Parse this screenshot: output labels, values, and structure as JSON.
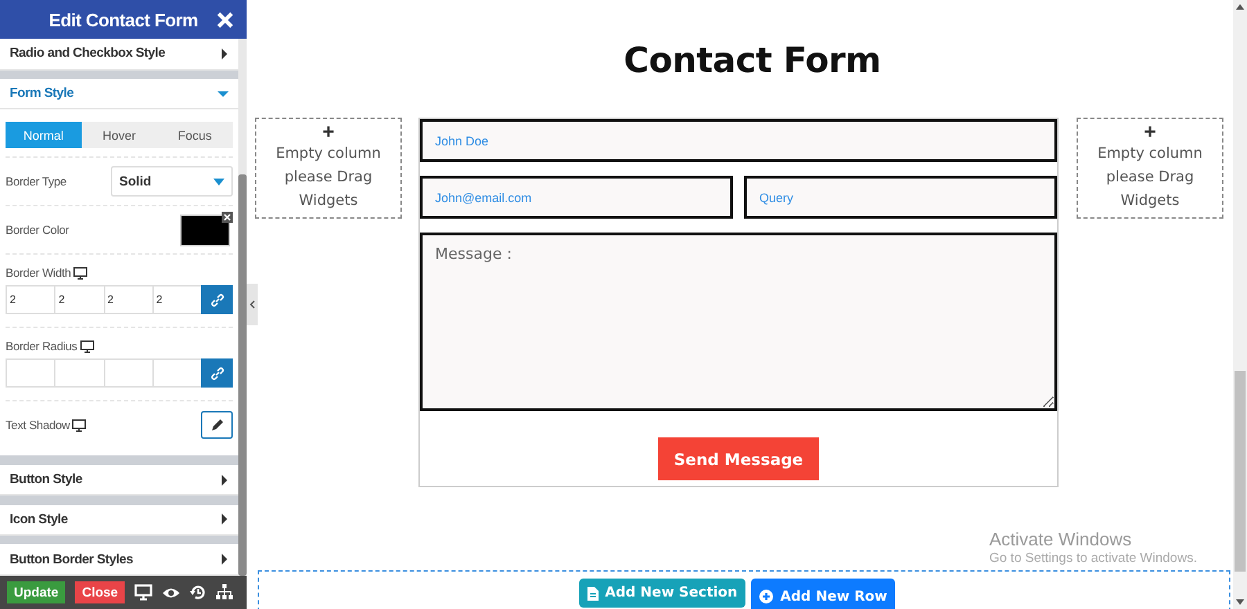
{
  "panel": {
    "title": "Edit Contact Form",
    "sections_before": [
      {
        "title": "Radio and Checkbox Style",
        "expanded": false
      }
    ],
    "form_style": {
      "title": "Form Style",
      "expanded": true,
      "tabs": [
        {
          "label": "Normal",
          "selected": true
        },
        {
          "label": "Hover",
          "selected": false
        },
        {
          "label": "Focus",
          "selected": false
        }
      ],
      "border_type": {
        "label": "Border Type",
        "value": "Solid"
      },
      "border_color": {
        "label": "Border Color",
        "color": "#000000"
      },
      "border_width": {
        "label": "Border Width",
        "values": [
          "2",
          "2",
          "2",
          "2"
        ]
      },
      "border_radius": {
        "label": "Border Radius"
      },
      "text_shadow": {
        "label": "Text Shadow"
      }
    },
    "sections_after": [
      {
        "title": "Button Style",
        "expanded": false
      },
      {
        "title": "Icon Style",
        "expanded": false
      },
      {
        "title": "Button Border Styles",
        "expanded": false
      }
    ],
    "footer_buttons": [
      {
        "label": "Update",
        "kind": "update"
      },
      {
        "label": "Close",
        "kind": "close"
      }
    ]
  },
  "page": {
    "heading": "Contact Form",
    "empty_columns": [
      {
        "plus": "+",
        "text": "Empty column please Drag Widgets"
      },
      {
        "plus": "+",
        "text": "Empty column please Drag Widgets"
      }
    ],
    "form": {
      "name_placeholder": "John Doe",
      "email_placeholder": "John@email.com",
      "query_placeholder": "Query",
      "message_placeholder": "Message :",
      "submit": "Send Message"
    },
    "add_buttons": [
      {
        "label": "Add New Section",
        "kind": "section"
      },
      {
        "label": "Add New Row",
        "kind": "row"
      }
    ]
  },
  "watermark": {
    "title": "Activate Windows",
    "subtitle": "Go to Settings to activate Windows."
  }
}
